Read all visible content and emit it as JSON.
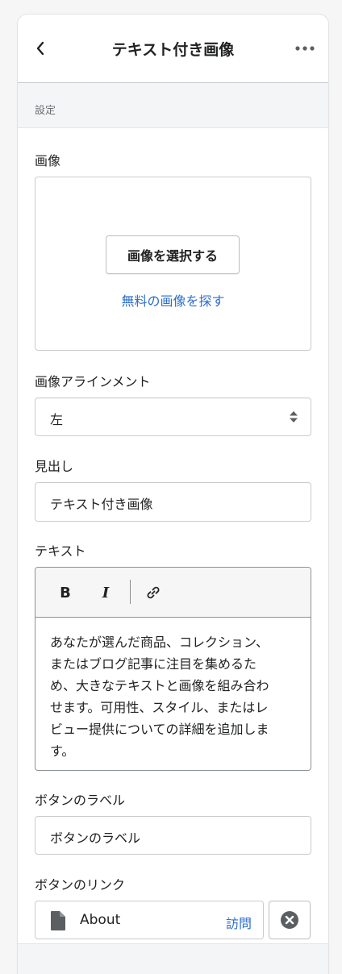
{
  "header": {
    "title": "テキスト付き画像",
    "back_icon": "chevron-left-icon",
    "more_icon": "horizontal-dots-icon"
  },
  "section": {
    "label": "設定"
  },
  "image": {
    "label": "画像",
    "select_button": "画像を選択する",
    "free_images_link": "無料の画像を探す"
  },
  "alignment": {
    "label": "画像アラインメント",
    "selected": "左",
    "arrow_icon": "select-arrows-icon"
  },
  "heading": {
    "label": "見出し",
    "value": "テキスト付き画像"
  },
  "text": {
    "label": "テキスト",
    "toolbar": {
      "bold": "B",
      "italic": "I",
      "link_icon": "link-icon"
    },
    "lines": [
      "あなたが選んだ商品、コレクション、",
      "またはブログ記事に注目を集めるた",
      "め、大きなテキストと画像を組み合わ",
      "せます。可用性、スタイル、またはレ",
      "ビュー提供についての詳細を追加しま",
      "す。"
    ]
  },
  "button_label": {
    "label": "ボタンのラベル",
    "value": "ボタンのラベル"
  },
  "button_link": {
    "label": "ボタンのリンク",
    "page_icon": "page-icon",
    "value": "About",
    "visit": "訪問",
    "clear_icon": "circle-x-icon"
  },
  "colors": {
    "link": "#2c6ecb",
    "text": "#202223",
    "border": "#c9cccf",
    "section_bg": "#f4f5f6"
  }
}
